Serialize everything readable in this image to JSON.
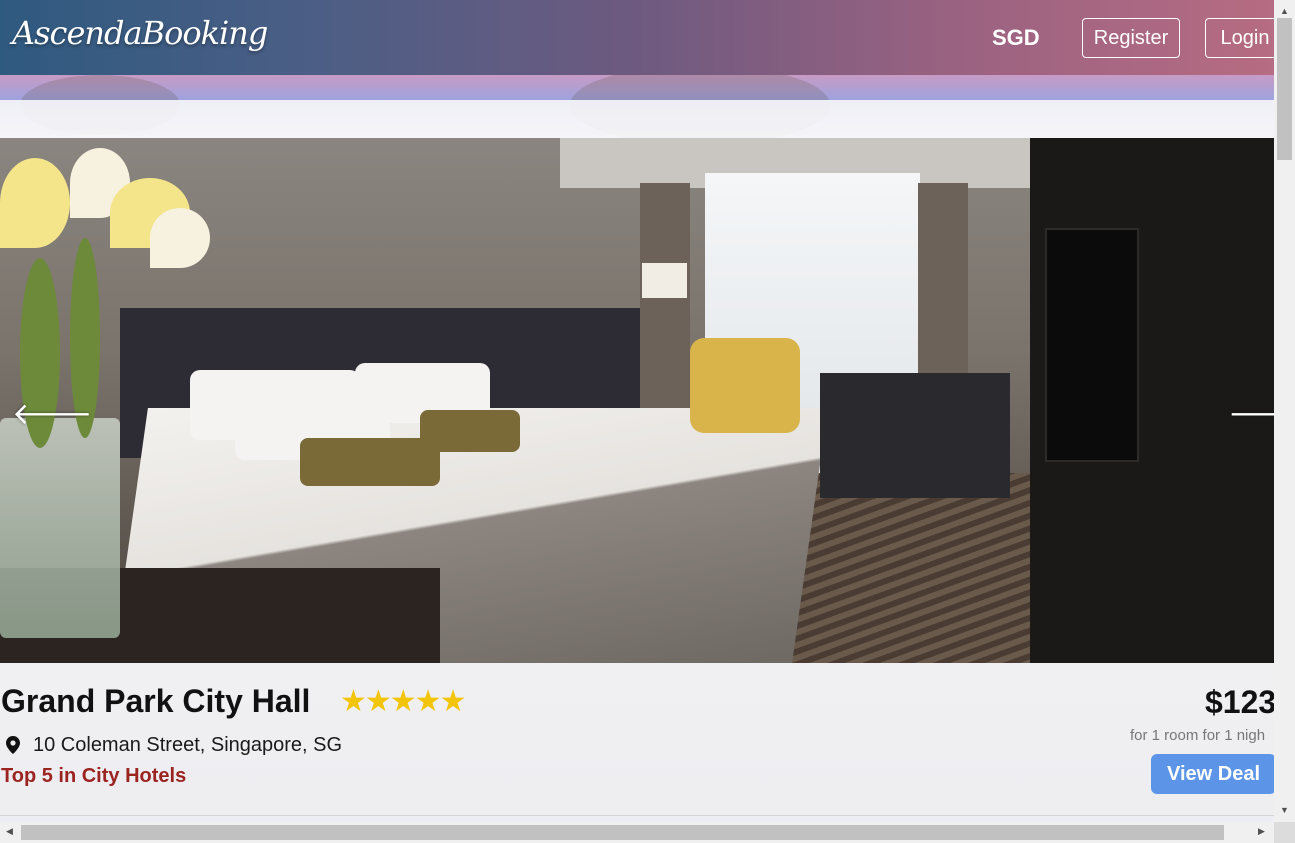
{
  "header": {
    "brand": "AscendaBooking",
    "currency": "SGD",
    "register_label": "Register",
    "login_label": "Login"
  },
  "carousel": {
    "prev_icon": "arrow-left-icon",
    "next_icon": "arrow-right-icon",
    "prev_glyph": "🡐",
    "next_glyph": "🡒"
  },
  "hotel": {
    "name": "Grand Park City Hall",
    "stars_rating": 5,
    "stars_glyphs": "★★★★★",
    "address": "10 Coleman Street, Singapore, SG",
    "rank": "Top 5 in City Hotels",
    "price": "$123",
    "price_note": "for 1 room for 1 nigh",
    "view_deal_label": "View Deal"
  },
  "colors": {
    "star": "#f2c40a",
    "rank_text": "#9b2420",
    "view_deal_bg": "#5c95e8"
  }
}
